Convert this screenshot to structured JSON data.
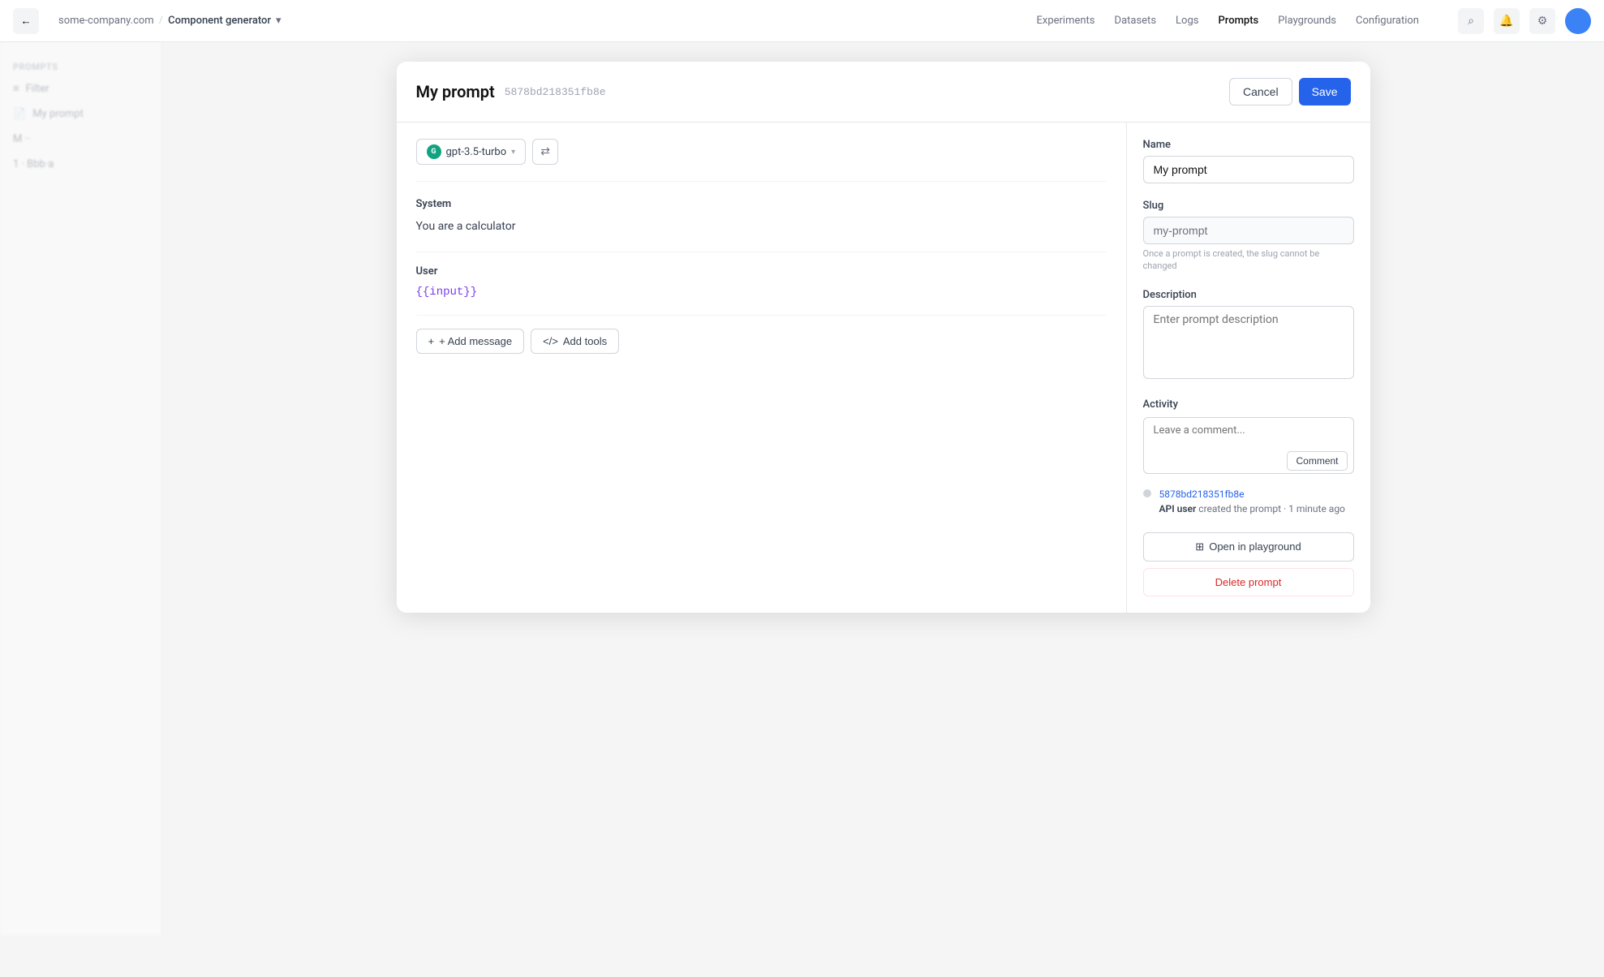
{
  "navbar": {
    "back_label": "←",
    "breadcrumb": {
      "org": "some-company.com",
      "separator": "/",
      "project": "Component generator",
      "dropdown_icon": "▾"
    },
    "menu_items": [
      "Experiments",
      "Datasets",
      "Logs",
      "Prompts",
      "Playgrounds",
      "Configuration"
    ],
    "icon_search": "⌕",
    "icon_bell": "🔔",
    "icon_settings": "⚙"
  },
  "sidebar": {
    "section_title": "Prompts",
    "items": [
      {
        "label": "Filter",
        "icon": "≡",
        "active": false
      },
      {
        "label": "My prompt",
        "icon": "📄",
        "active": false
      },
      {
        "label": "...",
        "icon": "",
        "active": false
      },
      {
        "label": "1 · Bbb·a",
        "icon": "",
        "active": false
      }
    ]
  },
  "modal": {
    "title": "My prompt",
    "id": "5878bd218351fb8e",
    "cancel_label": "Cancel",
    "save_label": "Save",
    "model_selector": {
      "name": "gpt-3.5-turbo",
      "icon_label": "G",
      "chevron": "▾"
    },
    "settings_icon": "⇄",
    "sections": [
      {
        "label": "System",
        "content": "You are a calculator",
        "is_template": false
      },
      {
        "label": "User",
        "content": "{{input}}",
        "is_template": true
      }
    ],
    "add_message_label": "+ Add message",
    "add_tools_label": "</> Add tools",
    "right_panel": {
      "name_label": "Name",
      "name_value": "My prompt",
      "name_placeholder": "My prompt",
      "slug_label": "Slug",
      "slug_value": "my-prompt",
      "slug_placeholder": "my-prompt",
      "slug_hint": "Once a prompt is created, the slug cannot be changed",
      "description_label": "Description",
      "description_placeholder": "Enter prompt description",
      "activity_label": "Activity",
      "comment_placeholder": "Leave a comment...",
      "comment_button_label": "Comment",
      "activity_entries": [
        {
          "link_text": "5878bd218351fb8e",
          "author": "API user",
          "action": "created the prompt",
          "timestamp": "1 minute ago"
        }
      ],
      "open_playground_label": "⊞ Open in playground",
      "delete_prompt_label": "Delete prompt"
    }
  }
}
